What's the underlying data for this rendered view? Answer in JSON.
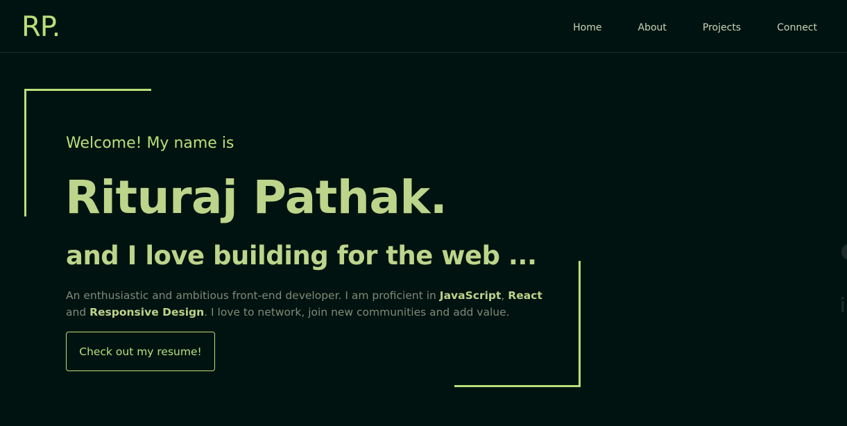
{
  "header": {
    "logo": "RP.",
    "nav": [
      {
        "label": "Home"
      },
      {
        "label": "About"
      },
      {
        "label": "Projects"
      },
      {
        "label": "Connect"
      }
    ]
  },
  "hero": {
    "welcome": "Welcome! My name is",
    "name": "Rituraj Pathak.",
    "tagline": "and I love building for the web ...",
    "description": {
      "part1": "An enthusiastic and ambitious front-end developer. I am proficient in ",
      "skill1": "JavaScript",
      "sep1": ", ",
      "skill2": "React",
      "part2": " and ",
      "skill3": "Responsive Design",
      "part3": ". I love to network, join new communities and add value."
    },
    "resume_button": "Check out my resume!"
  },
  "side_icons": [
    {
      "icon": "github-icon"
    },
    {
      "icon": "linkedin-icon"
    }
  ],
  "colors": {
    "background": "#001310",
    "accent": "#b8e07a",
    "accent_soft": "#bdd48b",
    "muted_text": "#7f8b78"
  }
}
